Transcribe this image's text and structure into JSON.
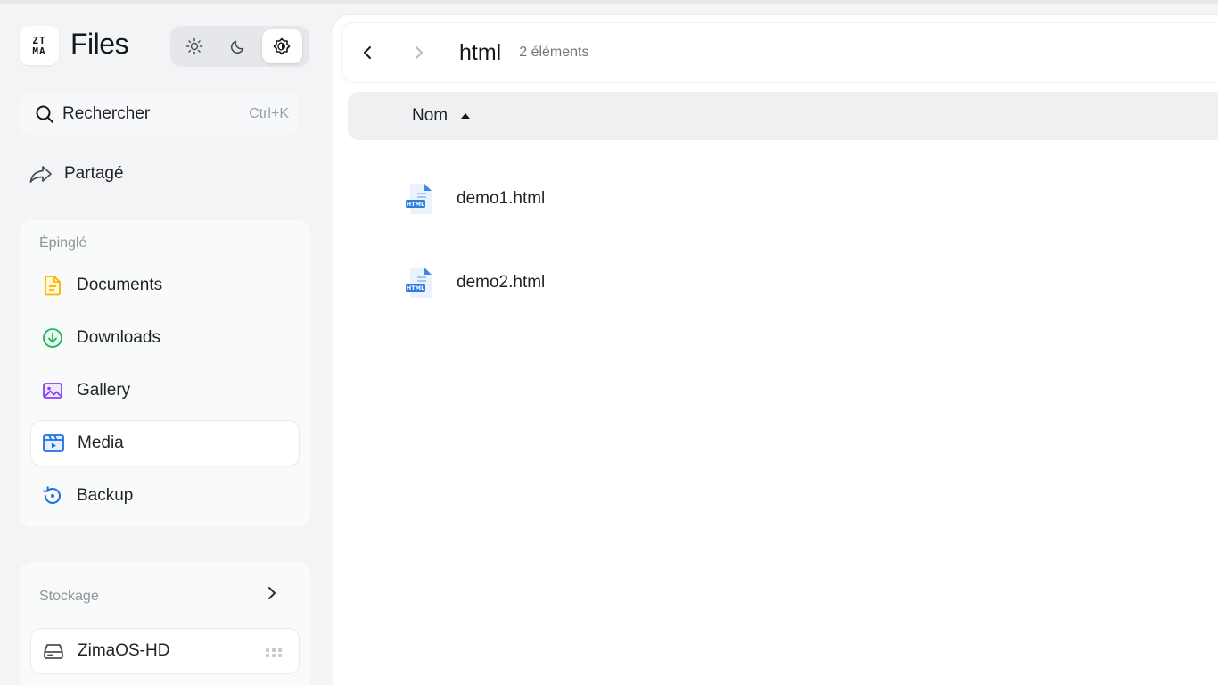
{
  "app": {
    "title": "Files",
    "logo_text_top": "ZT",
    "logo_text_bottom": "MA"
  },
  "theme": {
    "options": [
      "light",
      "dark",
      "auto"
    ],
    "selected": "auto"
  },
  "search": {
    "label": "Rechercher",
    "shortcut": "Ctrl+K"
  },
  "shared": {
    "label": "Partagé"
  },
  "pinned": {
    "title": "Épinglé",
    "items": [
      {
        "label": "Documents",
        "icon": "document-icon",
        "color": "#f5b700"
      },
      {
        "label": "Downloads",
        "icon": "download-icon",
        "color": "#22b35e"
      },
      {
        "label": "Gallery",
        "icon": "gallery-icon",
        "color": "#8b3ff0"
      },
      {
        "label": "Media",
        "icon": "media-icon",
        "color": "#1f6fe5",
        "active": true
      },
      {
        "label": "Backup",
        "icon": "backup-icon",
        "color": "#1f6fe5"
      }
    ]
  },
  "storage": {
    "title": "Stockage",
    "drives": [
      {
        "label": "ZimaOS-HD",
        "icon": "hard-drive-icon"
      }
    ]
  },
  "toolbar": {
    "folder": "html",
    "count": "2 éléments"
  },
  "columns": {
    "name": "Nom",
    "sort": "ascending"
  },
  "files": [
    {
      "name": "demo1.html",
      "type": "HTML"
    },
    {
      "name": "demo2.html",
      "type": "HTML"
    }
  ]
}
